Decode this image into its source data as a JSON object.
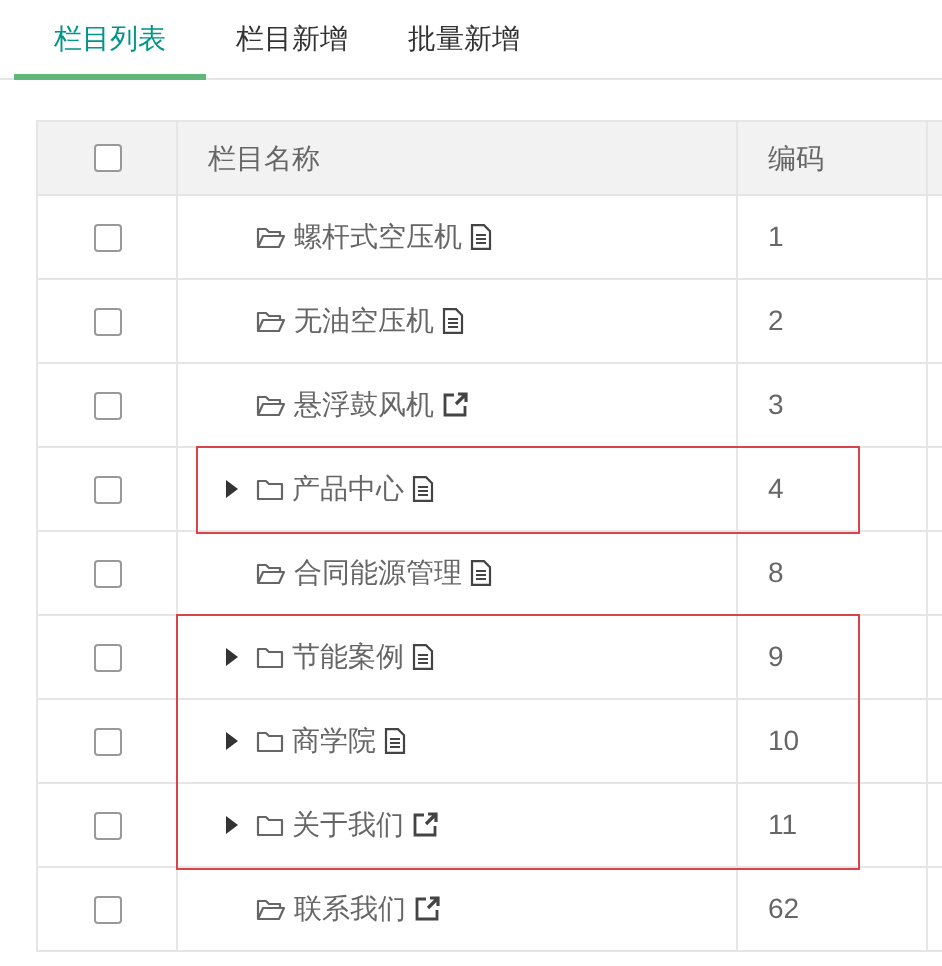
{
  "tabs": [
    {
      "label": "栏目列表",
      "selected": true
    },
    {
      "label": "栏目新增",
      "selected": false
    },
    {
      "label": "批量新增",
      "selected": false
    }
  ],
  "table": {
    "columns": [
      "栏目名称",
      "编码"
    ],
    "header_checked": false,
    "rows": [
      {
        "name": "螺杆式空压机",
        "code": "1",
        "kind": "leaf",
        "external": false,
        "checked": false,
        "highlighted": false
      },
      {
        "name": "无油空压机",
        "code": "2",
        "kind": "leaf",
        "external": false,
        "checked": false,
        "highlighted": false
      },
      {
        "name": "悬浮鼓风机",
        "code": "3",
        "kind": "leaf",
        "external": true,
        "checked": false,
        "highlighted": false
      },
      {
        "name": "产品中心",
        "code": "4",
        "kind": "branch",
        "external": false,
        "checked": false,
        "highlighted": true
      },
      {
        "name": "合同能源管理",
        "code": "8",
        "kind": "leaf",
        "external": false,
        "checked": false,
        "highlighted": false
      },
      {
        "name": "节能案例",
        "code": "9",
        "kind": "branch",
        "external": false,
        "checked": false,
        "highlighted": true
      },
      {
        "name": "商学院",
        "code": "10",
        "kind": "branch",
        "external": false,
        "checked": false,
        "highlighted": true
      },
      {
        "name": "关于我们",
        "code": "11",
        "kind": "branch",
        "external": true,
        "checked": false,
        "highlighted": true
      },
      {
        "name": "联系我们",
        "code": "62",
        "kind": "leaf",
        "external": true,
        "checked": false,
        "highlighted": false
      }
    ]
  }
}
